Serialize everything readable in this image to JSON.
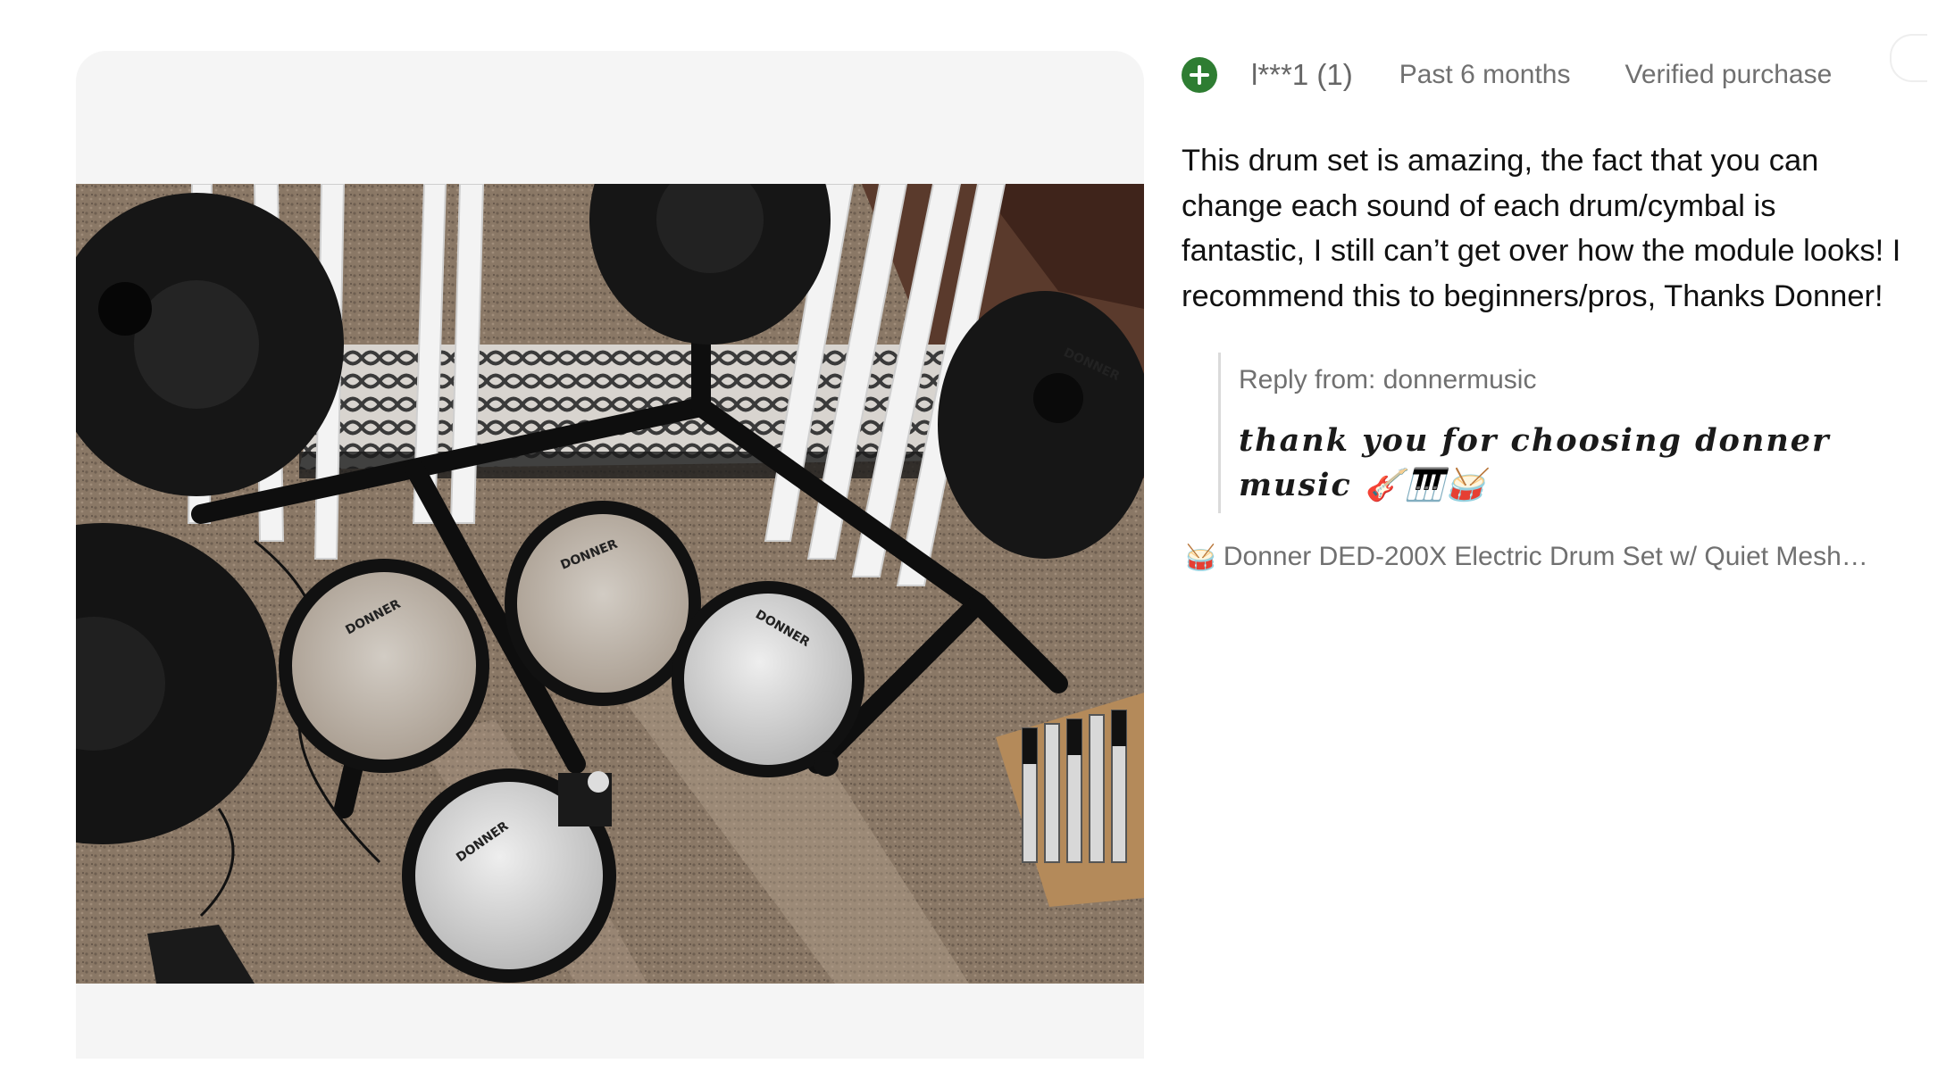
{
  "review": {
    "badge_icon": "plus-circle-icon",
    "badge_color": "#2e7d32",
    "username": "l***1 (1)",
    "date": "Past 6 months",
    "purchase_status": "Verified purchase",
    "body": "This drum set is amazing, the fact that you can change each sound of each drum/cymbal is fantastic, I still can’t get over how the module looks! I recommend this to beginners/pros, Thanks Donner!"
  },
  "reply": {
    "label": "Reply from: donnermusic",
    "text": "thank you for choosing donner music 🎸🎹🥁"
  },
  "product": {
    "icon": "🥁",
    "name": "Donner DED-200X Electric Drum Set w/ Quiet Mesh…"
  },
  "photo": {
    "pad_brand": "DONNER"
  }
}
